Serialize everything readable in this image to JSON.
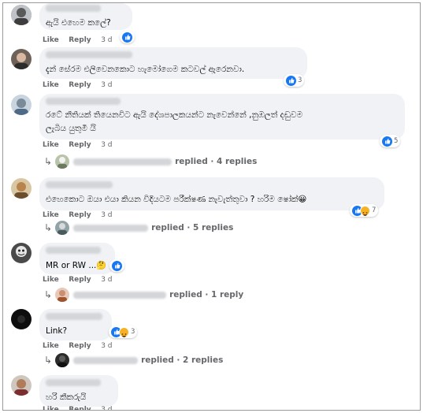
{
  "actions": {
    "like": "Like",
    "reply": "Reply"
  },
  "comments": [
    {
      "text": "ඇයි එහෙම කලේ?",
      "time": "3 d",
      "reactions": {
        "types": [
          "like"
        ],
        "count": ""
      }
    },
    {
      "text": "දැන් සේරම එලිවෙනකොට හැමෝගෙම කටවල් ඇරෙනවා.",
      "time": "3 d",
      "reactions": {
        "types": [
          "like"
        ],
        "count": "3"
      }
    },
    {
      "text1": "රටේ නීතියක් තියෙනවිට ඇයි දේශපාලකයන්ට නැවෙන්නේ ,නුඹලත් දඬුවම",
      "text2": "ලැබිය යුතුමී යි",
      "time": "3 d",
      "reactions": {
        "types": [
          "like"
        ],
        "count": "5"
      },
      "replies": "replied · 4 replies"
    },
    {
      "text": "එහෙකොට ඔයා එයා කියන විදියටම පරීක්ෂණ නැවැත්තුවා ? හරිම ෂෝක්😀",
      "time": "3 d",
      "reactions": {
        "types": [
          "like",
          "haha"
        ],
        "count": "7"
      },
      "replies": "replied · 5 replies"
    },
    {
      "text": "MR or RW ...🤔",
      "time": "3 d",
      "reactions": {
        "types": [
          "like"
        ],
        "count": ""
      },
      "replies": "replied · 1 reply"
    },
    {
      "text": "Link?",
      "time": "3 d",
      "reactions": {
        "types": [
          "like",
          "haha"
        ],
        "count": "3"
      },
      "replies": "replied · 2 replies"
    },
    {
      "text": "හරි කීකරුයි",
      "time": "3 d"
    }
  ],
  "colors": {
    "like_blue": "#1877f2",
    "haha_yellow": "#f7b125",
    "bubble": "#f0f2f5",
    "meta_gray": "#65676b"
  }
}
